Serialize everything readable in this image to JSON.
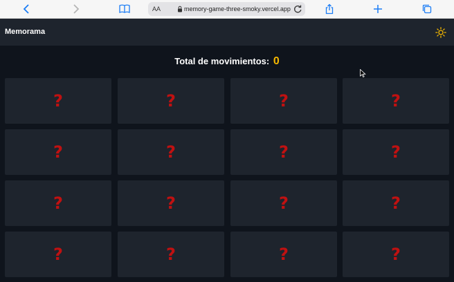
{
  "browser": {
    "text_size_label": "AA",
    "url": "memory-game-three-smoky.vercel.app"
  },
  "app": {
    "brand": "Memorama",
    "moves_label": "Total de movimientos:",
    "moves_count": "0"
  },
  "cards": [
    "?",
    "?",
    "?",
    "?",
    "?",
    "?",
    "?",
    "?",
    "?",
    "?",
    "?",
    "?",
    "?",
    "?",
    "?",
    "?"
  ],
  "colors": {
    "page_bg": "#0f141c",
    "card_bg": "#1e242d",
    "question_mark": "#c01111",
    "count_accent": "#f5b800",
    "theme_icon": "#f5b800"
  }
}
